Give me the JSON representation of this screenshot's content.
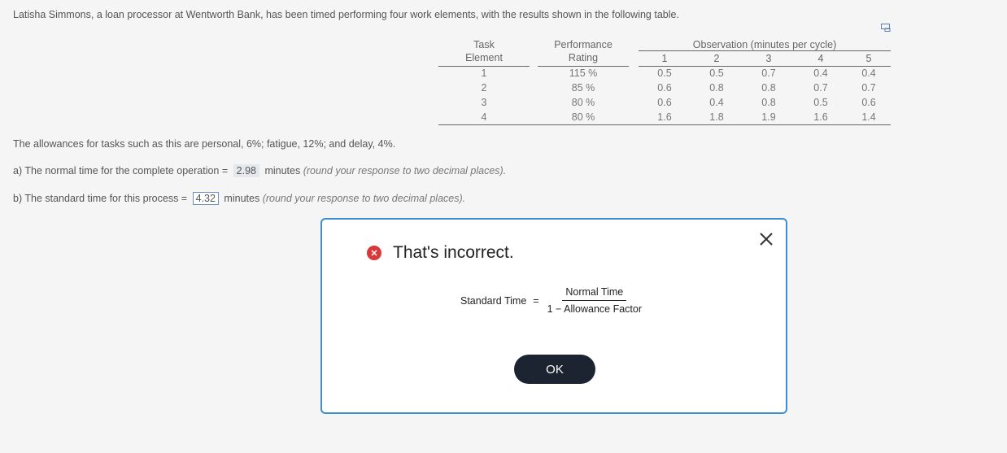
{
  "problem": {
    "intro": "Latisha Simmons, a loan processor at Wentworth Bank, has been timed performing four work elements, with the results shown in the following table.",
    "allowances": "The allowances for tasks such as this are personal, 6%; fatigue, 12%; and delay, 4%."
  },
  "table": {
    "task_header_1": "Task",
    "task_header_2": "Element",
    "rating_header_1": "Performance",
    "rating_header_2": "Rating",
    "obs_header": "Observation (minutes per cycle)",
    "obs_columns": [
      "1",
      "2",
      "3",
      "4",
      "5"
    ],
    "rows": [
      {
        "task": "1",
        "rating": "115 %",
        "obs": [
          "0.5",
          "0.5",
          "0.7",
          "0.4",
          "0.4"
        ]
      },
      {
        "task": "2",
        "rating": "85 %",
        "obs": [
          "0.6",
          "0.8",
          "0.8",
          "0.7",
          "0.7"
        ]
      },
      {
        "task": "3",
        "rating": "80 %",
        "obs": [
          "0.6",
          "0.4",
          "0.8",
          "0.5",
          "0.6"
        ]
      },
      {
        "task": "4",
        "rating": "80 %",
        "obs": [
          "1.6",
          "1.8",
          "1.9",
          "1.6",
          "1.4"
        ]
      }
    ]
  },
  "question_a": {
    "prefix": "a) The normal time for the complete operation =",
    "answer": "2.98",
    "units": "minutes",
    "hint": "(round your response to two decimal places)."
  },
  "question_b": {
    "prefix": "b) The standard time for this process =",
    "answer": "4.32",
    "units": "minutes",
    "hint": "(round your response to two decimal places)."
  },
  "modal": {
    "status": "That's incorrect.",
    "formula_lhs": "Standard Time",
    "formula_eq": "=",
    "formula_numerator": "Normal Time",
    "formula_denominator": "1 − Allowance Factor",
    "ok_label": "OK",
    "error_color": "#d9383a",
    "border_color": "#3a8fd0"
  }
}
